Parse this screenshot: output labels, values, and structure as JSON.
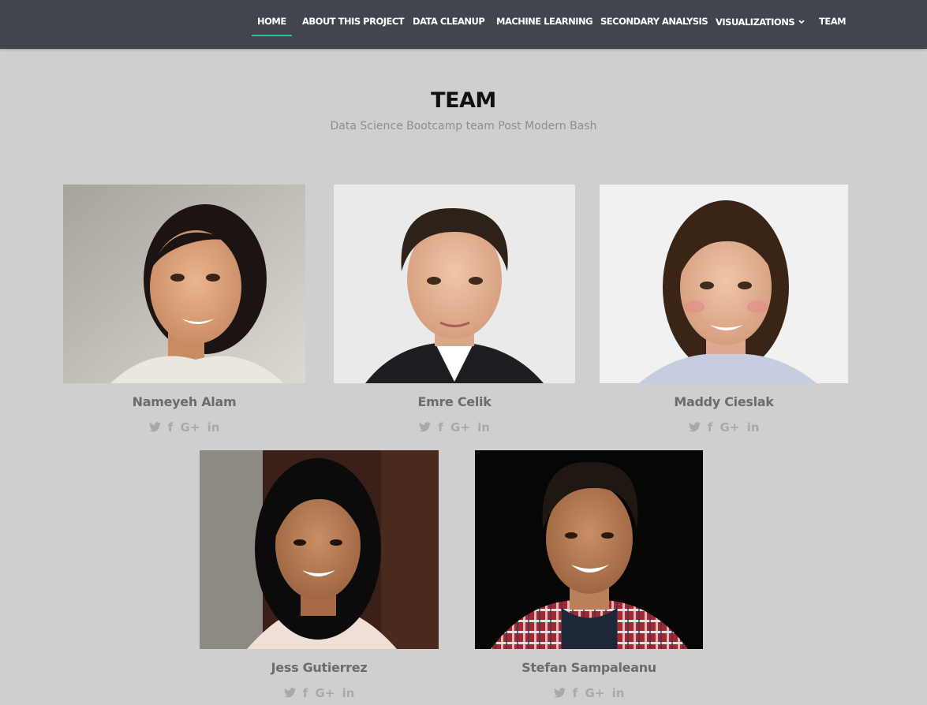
{
  "nav": {
    "items": [
      {
        "label": "HOME",
        "active": true
      },
      {
        "label": "ABOUT THIS PROJECT"
      },
      {
        "label": "DATA CLEANUP"
      },
      {
        "label": "MACHINE LEARNING"
      },
      {
        "label": "SECONDARY ANALYSIS"
      },
      {
        "label": "VISUALIZATIONS",
        "icon": "chevron-down-icon"
      },
      {
        "label": "TEAM"
      }
    ],
    "active_color": "#2fbf93",
    "background": "#41464d"
  },
  "header": {
    "title": "TEAM",
    "subtitle": "Data Science Bootcamp team Post Modern Bash"
  },
  "team": [
    {
      "name": "Nameyeh Alam",
      "socials": {
        "twitter": "twitter-icon",
        "facebook": "f",
        "google": "G+",
        "linkedin": "in"
      }
    },
    {
      "name": "Emre Celik",
      "socials": {
        "twitter": "twitter-icon",
        "facebook": "f",
        "google": "G+",
        "linkedin": "in"
      }
    },
    {
      "name": "Maddy Cieslak",
      "socials": {
        "twitter": "twitter-icon",
        "facebook": "f",
        "google": "G+",
        "linkedin": "in"
      }
    },
    {
      "name": "Jess Gutierrez",
      "socials": {
        "twitter": "twitter-icon",
        "facebook": "f",
        "google": "G+",
        "linkedin": "in"
      }
    },
    {
      "name": "Stefan Sampaleanu",
      "socials": {
        "twitter": "twitter-icon",
        "facebook": "f",
        "google": "G+",
        "linkedin": "in"
      }
    }
  ]
}
